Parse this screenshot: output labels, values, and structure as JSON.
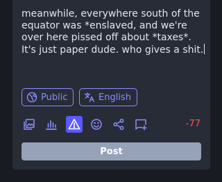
{
  "compose": {
    "text": "meanwhile, everywhere south of the equator was *enslaved, and we're over here pissed off about *taxes*. It's just paper dude. who gives a shit.",
    "visibility_label": "Public",
    "language_label": "English",
    "char_counter": "-77",
    "post_label": "Post"
  },
  "toolbar": {
    "icons": [
      "image-icon",
      "poll-icon",
      "content-warning-icon",
      "emoji-icon",
      "share-icon",
      "thread-icon"
    ],
    "active": "content-warning-icon"
  },
  "colors": {
    "accent": "#8c8dff",
    "active_bg": "#595aff",
    "counter": "#ff5050",
    "post_button": "#95a2b8",
    "panel": "#282c37",
    "background": "#191b22"
  }
}
